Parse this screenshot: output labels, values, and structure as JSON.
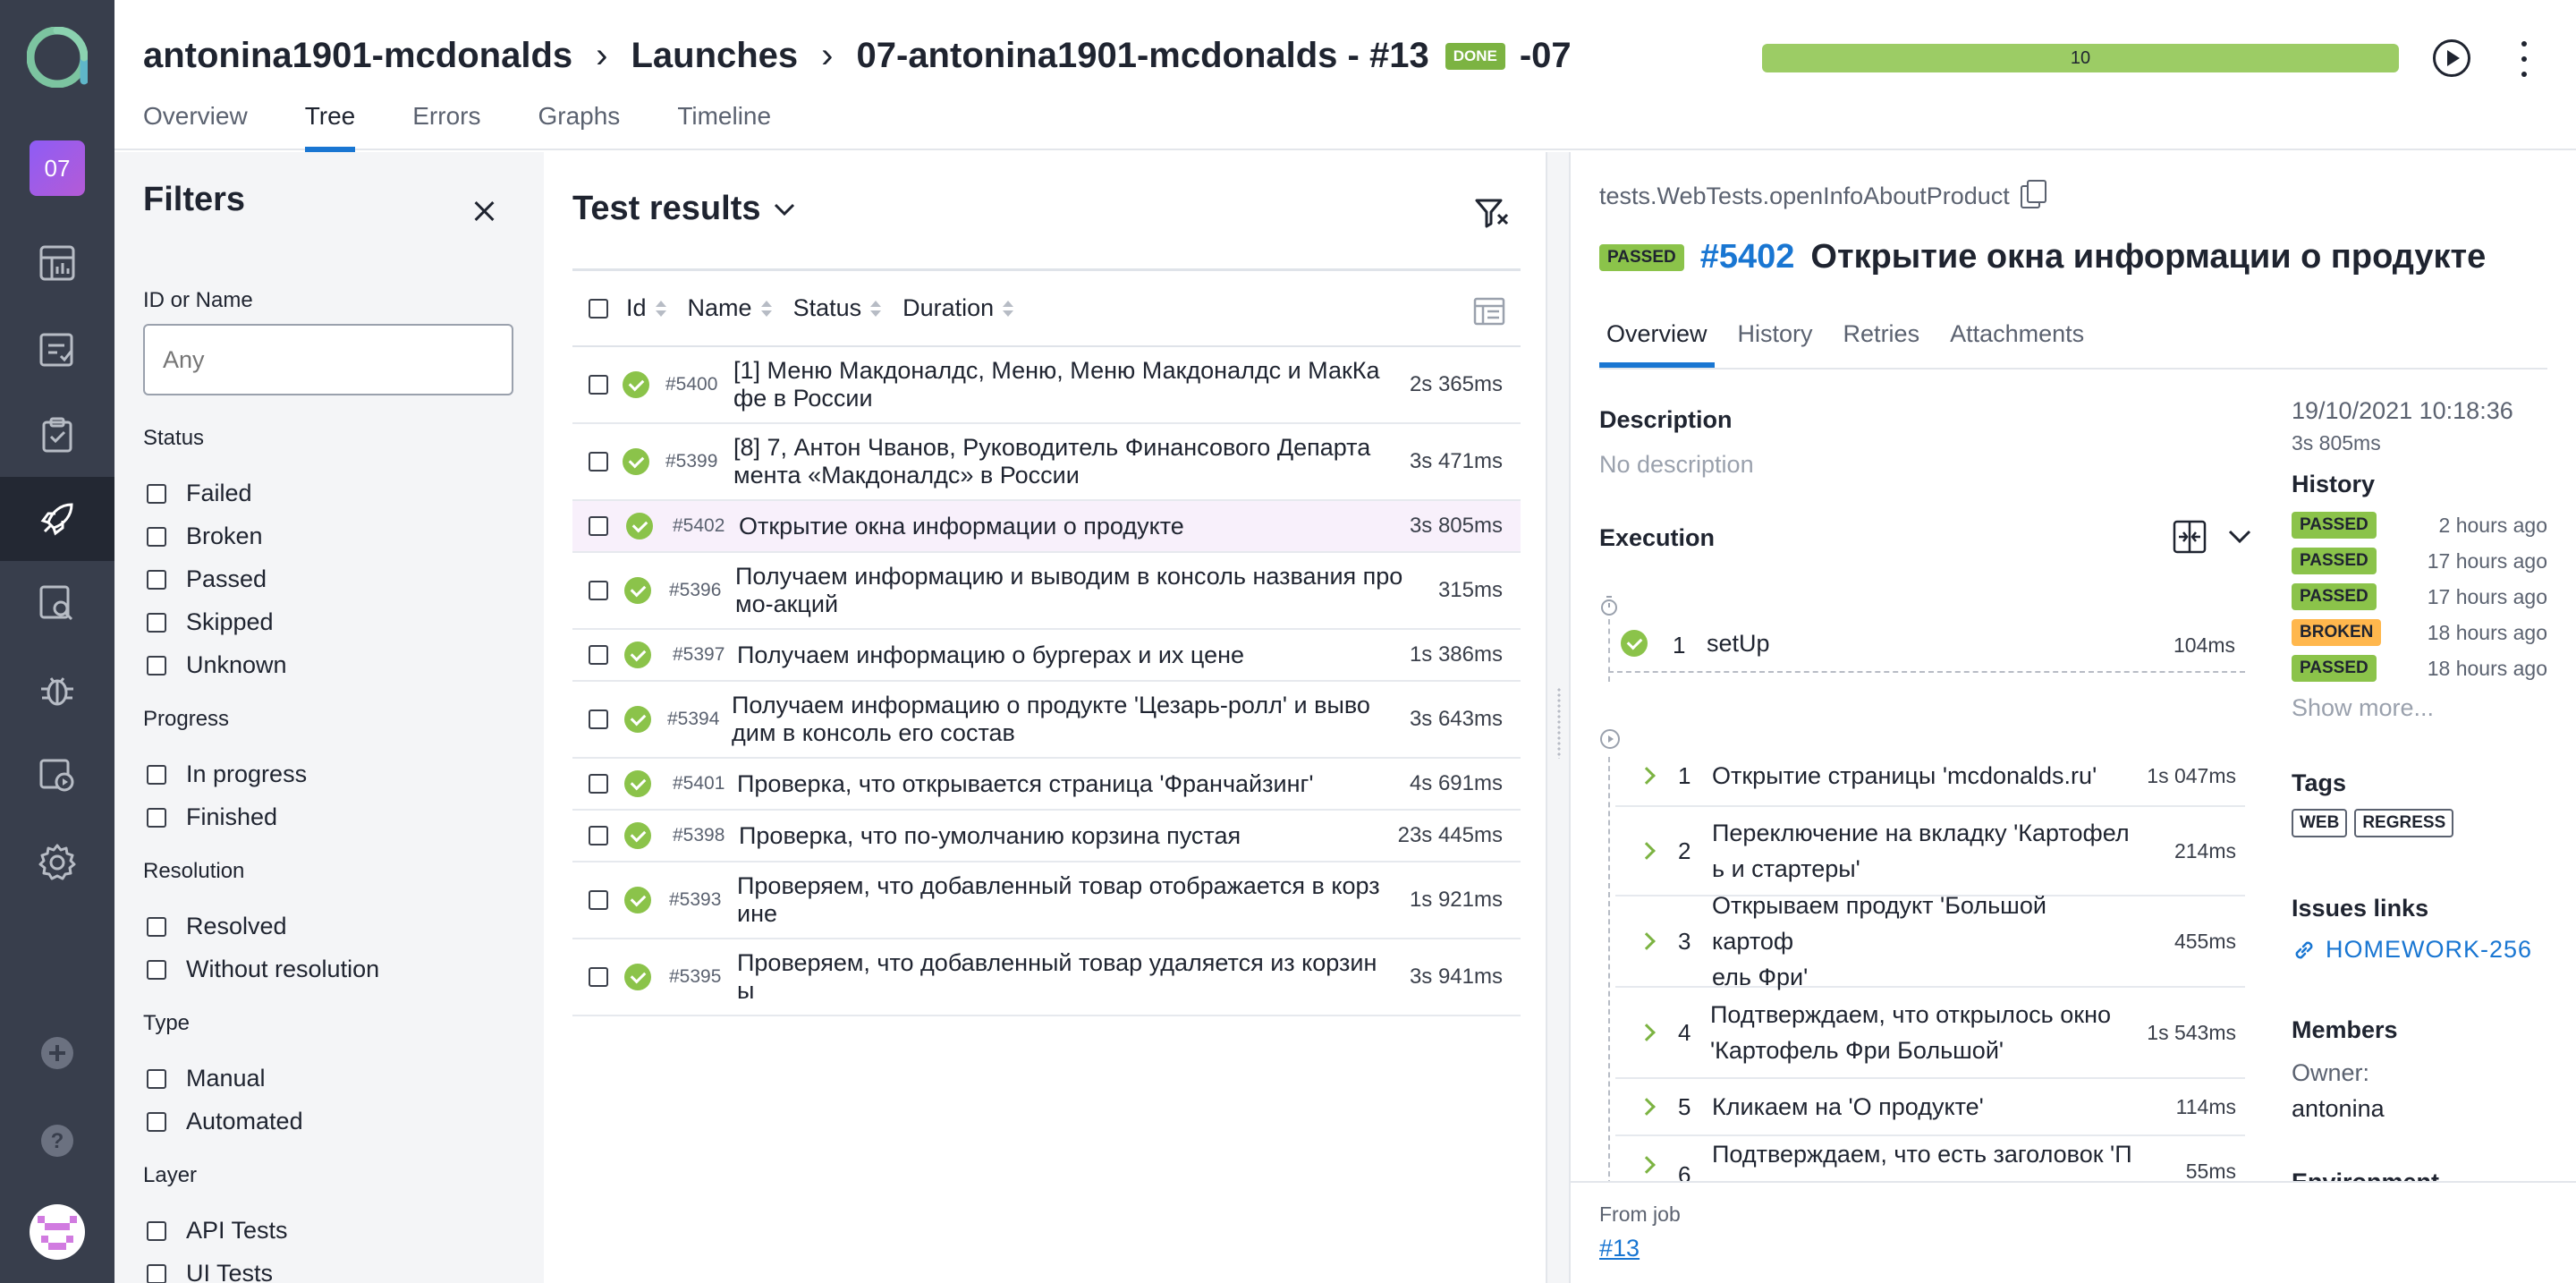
{
  "rail": {
    "project_badge": "07"
  },
  "header": {
    "breadcrumb": [
      "antonina1901-mcdonalds",
      "Launches",
      "07-antonina1901-mcdonalds - #13"
    ],
    "status_badge": "DONE",
    "launch_suffix": "-07",
    "progress_value": "10",
    "tabs": [
      "Overview",
      "Tree",
      "Errors",
      "Graphs",
      "Timeline"
    ],
    "active_tab": "Tree"
  },
  "filters": {
    "title": "Filters",
    "id_label": "ID or Name",
    "id_placeholder": "Any",
    "groups": [
      {
        "label": "Status",
        "options": [
          "Failed",
          "Broken",
          "Passed",
          "Skipped",
          "Unknown"
        ]
      },
      {
        "label": "Progress",
        "options": [
          "In progress",
          "Finished"
        ]
      },
      {
        "label": "Resolution",
        "options": [
          "Resolved",
          "Without resolution"
        ]
      },
      {
        "label": "Type",
        "options": [
          "Manual",
          "Automated"
        ]
      },
      {
        "label": "Layer",
        "options": [
          "API Tests",
          "UI Tests"
        ]
      }
    ]
  },
  "results": {
    "title": "Test results",
    "columns": [
      "Id",
      "Name",
      "Status",
      "Duration"
    ],
    "rows": [
      {
        "id": "#5400",
        "name": "[1] Меню Макдоналдс, Меню, Меню Макдоналдс и МакКа\nфе в России",
        "duration": "2s 365ms"
      },
      {
        "id": "#5399",
        "name": "[8] 7, Антон Чванов, Руководитель Финансового Департа\nмента «Макдоналдс» в России",
        "duration": "3s 471ms"
      },
      {
        "id": "#5402",
        "name": "Открытие окна информации о продукте",
        "duration": "3s 805ms"
      },
      {
        "id": "#5396",
        "name": "Получаем информацию и выводим в консоль названия про\nмо-акций",
        "duration": "315ms"
      },
      {
        "id": "#5397",
        "name": "Получаем информацию о бургерах и их цене",
        "duration": "1s 386ms"
      },
      {
        "id": "#5394",
        "name": "Получаем информацию о продукте 'Цезарь-ролл' и выво\nдим в консоль его состав",
        "duration": "3s 643ms"
      },
      {
        "id": "#5401",
        "name": "Проверка, что открывается страница 'Франчайзинг'",
        "duration": "4s 691ms"
      },
      {
        "id": "#5398",
        "name": "Проверка, что по-умолчанию корзина пустая",
        "duration": "23s 445ms"
      },
      {
        "id": "#5393",
        "name": "Проверяем, что добавленный товар отображается в корз\nине",
        "duration": "1s 921ms"
      },
      {
        "id": "#5395",
        "name": "Проверяем, что добавленный товар удаляется из корзин\nы",
        "duration": "3s 941ms"
      }
    ]
  },
  "details": {
    "path": "tests.WebTests.openInfoAboutProduct",
    "status": "PASSED",
    "number": "#5402",
    "title": "Открытие окна информации о продукте",
    "tabs": [
      "Overview",
      "History",
      "Retries",
      "Attachments"
    ],
    "description_label": "Description",
    "description_value": "No description",
    "execution_label": "Execution",
    "setup_step": {
      "n": "1",
      "name": "setUp",
      "duration": "104ms"
    },
    "steps": [
      {
        "n": "1",
        "name": "Открытие страницы 'mcdonalds.ru'",
        "duration": "1s 047ms"
      },
      {
        "n": "2",
        "name": "Переключение на вкладку 'Картофел\nь и стартеры'",
        "duration": "214ms"
      },
      {
        "n": "3",
        "name": "Открываем продукт 'Большой картоф\nель Фри'",
        "duration": "455ms"
      },
      {
        "n": "4",
        "name": "Подтверждаем, что открылось окно\n'Картофель Фри Большой'",
        "duration": "1s 543ms"
      },
      {
        "n": "5",
        "name": "Кликаем на 'О продукте'",
        "duration": "114ms"
      },
      {
        "n": "6",
        "name": "Подтверждаем, что есть заголовок 'П",
        "duration": "55ms"
      }
    ],
    "date": "19/10/2021 10:18:36",
    "duration": "3s 805ms",
    "history_label": "History",
    "history": [
      {
        "status": "PASSED",
        "ago": "2 hours ago"
      },
      {
        "status": "PASSED",
        "ago": "17 hours ago"
      },
      {
        "status": "PASSED",
        "ago": "17 hours ago"
      },
      {
        "status": "BROKEN",
        "ago": "18 hours ago"
      },
      {
        "status": "PASSED",
        "ago": "18 hours ago"
      }
    ],
    "show_more": "Show more...",
    "tags_label": "Tags",
    "tags": [
      "WEB",
      "REGRESS"
    ],
    "issues_label": "Issues links",
    "issue": "HOMEWORK-256",
    "members_label": "Members",
    "owner_label": "Owner:",
    "owner": "antonina",
    "environment_label": "Environment",
    "from_job_label": "From job",
    "from_job_link": "#13"
  },
  "colors": {
    "accent": "#1976d2",
    "passed": "#8bc34a",
    "broken": "#ffb74d",
    "rail": "#383e4c"
  }
}
